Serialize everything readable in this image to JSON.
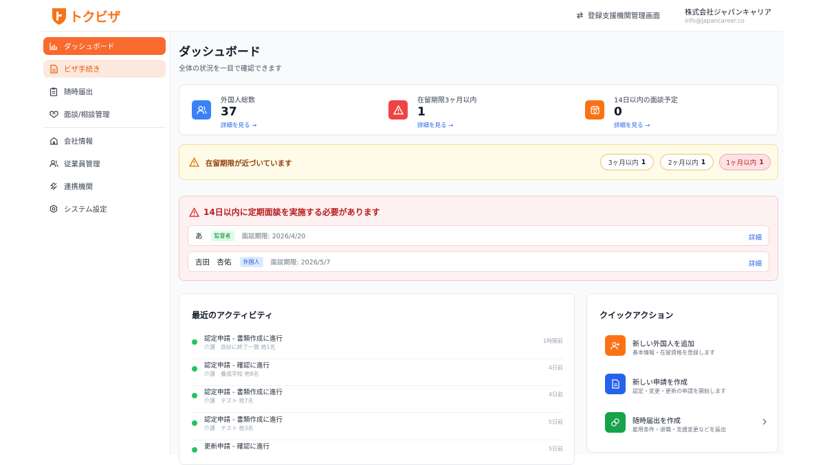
{
  "header": {
    "logo_text": "トクビザ",
    "admin_link": "登録支援機関管理画面",
    "company": "株式会社ジャパンキャリア",
    "email": "info@japancareer.co"
  },
  "sidebar": {
    "items": [
      {
        "label": "ダッシュボード",
        "icon": "bar-chart-icon"
      },
      {
        "label": "ビザ手続き",
        "icon": "document-icon"
      },
      {
        "label": "随時届出",
        "icon": "clipboard-icon"
      },
      {
        "label": "面談/相談管理",
        "icon": "handshake-icon"
      },
      {
        "label": "会社情報",
        "icon": "building-icon"
      },
      {
        "label": "従業員管理",
        "icon": "users-icon"
      },
      {
        "label": "連携機関",
        "icon": "link-icon"
      },
      {
        "label": "システム設定",
        "icon": "gear-icon"
      }
    ]
  },
  "page": {
    "title": "ダッシュボード",
    "subtitle": "全体の状況を一目で確認できます"
  },
  "stats": [
    {
      "label": "外国人総数",
      "value": "37",
      "link": "詳細を見る →",
      "color": "#3b82f6"
    },
    {
      "label": "在留期限3ヶ月以内",
      "value": "1",
      "link": "詳細を見る →",
      "color": "#ef4444"
    },
    {
      "label": "14日以内の面談予定",
      "value": "0",
      "link": "詳細を見る →",
      "color": "#f97316"
    }
  ],
  "warning": {
    "text": "在留期限が近づいています",
    "pills": [
      {
        "label": "3ヶ月以内",
        "count": "1"
      },
      {
        "label": "2ヶ月以内",
        "count": "1"
      },
      {
        "label": "1ヶ月以内",
        "count": "1"
      }
    ]
  },
  "interview_alert": {
    "title": "14日以内に定期面談を実施する必要があります",
    "rows": [
      {
        "name": "あ",
        "role": "監督者",
        "deadline": "面談期限: 2026/4/20",
        "detail": "詳細"
      },
      {
        "name": "吉田　杏佑",
        "role": "外国人",
        "deadline": "面談期限: 2026/5/7",
        "detail": "詳細"
      }
    ]
  },
  "activity": {
    "title": "最近のアクティビティ",
    "items": [
      {
        "title": "認定申請 - 書類作成に進行",
        "sub": "介護　良好に終了一致 他1名",
        "time": "1時間前"
      },
      {
        "title": "認定申請 - 確認に進行",
        "sub": "介護　養成学校 他8名",
        "time": "4日前"
      },
      {
        "title": "認定申請 - 書類作成に進行",
        "sub": "介護　テスト 他7名",
        "time": "4日前"
      },
      {
        "title": "認定申請 - 書類作成に進行",
        "sub": "介護　テスト 他3名",
        "time": "5日前"
      },
      {
        "title": "更新申請 - 確認に進行",
        "sub": "",
        "time": "5日前"
      }
    ]
  },
  "quick_actions": {
    "title": "クイックアクション",
    "items": [
      {
        "title": "新しい外国人を追加",
        "sub": "基本情報・在留資格を登録します",
        "color": "#f97316",
        "icon": "user-plus-icon"
      },
      {
        "title": "新しい申請を作成",
        "sub": "認定・変更・更新の申請を開始します",
        "color": "#2563eb",
        "icon": "file-icon"
      },
      {
        "title": "随時届出を作成",
        "sub": "雇用条件・退職・支援変更などを届出",
        "color": "#16a34a",
        "icon": "copy-icon"
      }
    ]
  }
}
